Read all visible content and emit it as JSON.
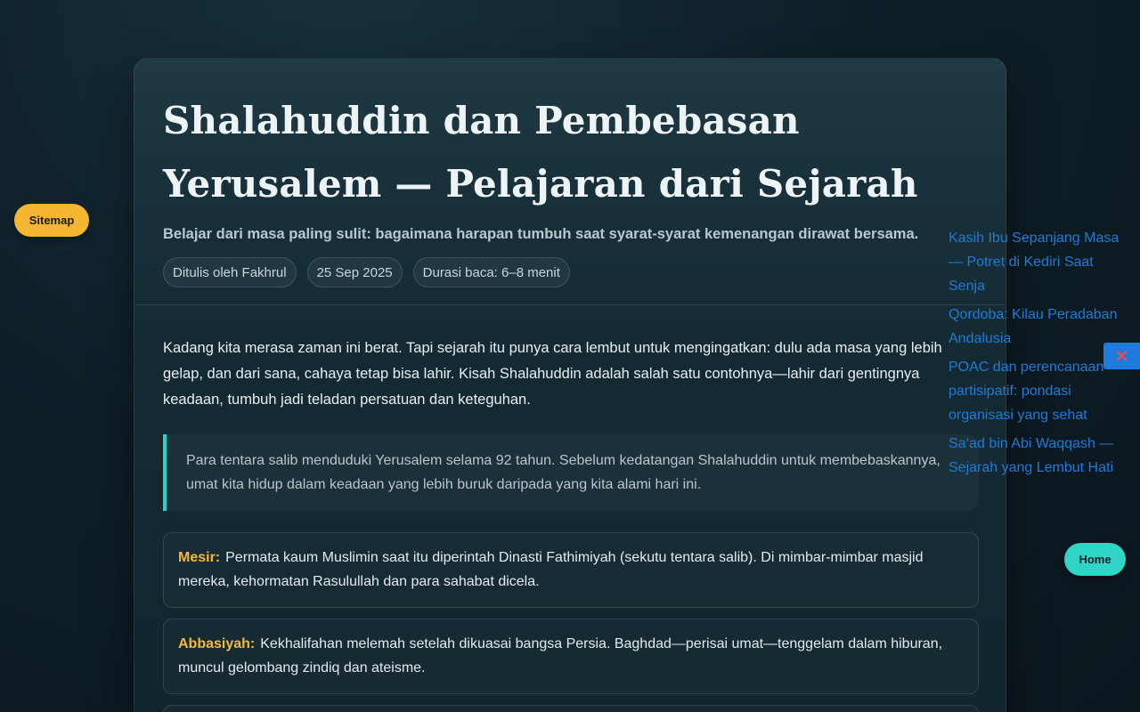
{
  "article": {
    "title": "Shalahuddin dan Pembebasan Yerusalem — Pelajaran dari Sejarah",
    "subtitle": "Belajar dari masa paling sulit: bagaimana harapan tumbuh saat syarat-syarat kemenangan dirawat bersama.",
    "meta": {
      "author": "Ditulis oleh Fakhrul",
      "date": "25 Sep 2025",
      "reading_time": "Durasi baca: 6–8 menit"
    },
    "intro": "Kadang kita merasa zaman ini berat. Tapi sejarah itu punya cara lembut untuk mengingatkan: dulu ada masa yang lebih gelap, dan dari sana, cahaya tetap bisa lahir. Kisah Shalahuddin adalah salah satu contohnya—lahir dari gentingnya keadaan, tumbuh jadi teladan persatuan dan keteguhan.",
    "quote": "Para tentara salib menduduki Yerusalem selama 92 tahun. Sebelum kedatangan Shalahuddin untuk membebaskannya, umat kita hidup dalam keadaan yang lebih buruk daripada yang kita alami hari ini.",
    "boxes": [
      {
        "label": "Mesir:",
        "text": "Permata kaum Muslimin saat itu diperintah Dinasti Fathimiyah (sekutu tentara salib). Di mimbar-mimbar masjid mereka, kehormatan Rasulullah dan para sahabat dicela."
      },
      {
        "label": "Abbasiyah:",
        "text": "Kekhalifahan melemah setelah dikuasai bangsa Persia. Baghdad—perisai umat—tenggelam dalam hiburan, muncul gelombang zindiq dan ateisme."
      }
    ]
  },
  "nav": {
    "sitemap_label": "Sitemap",
    "home_label": "Home",
    "close_symbol": "✕"
  },
  "related": [
    "Kasih Ibu Sepanjang Masa — Potret di Kediri Saat Senja",
    "Qordoba: Kilau Peradaban Andalusia",
    "POAC dan perencanaan partisipatif: pondasi organisasi yang sehat",
    "Sa‘ad bin Abi Waqqash — Sejarah yang Lembut Hati"
  ],
  "colors": {
    "accent_teal": "#2fd1c5",
    "accent_yellow": "#f5b631",
    "link_blue": "#1e7bd8",
    "close_red": "#ff4a4a"
  }
}
